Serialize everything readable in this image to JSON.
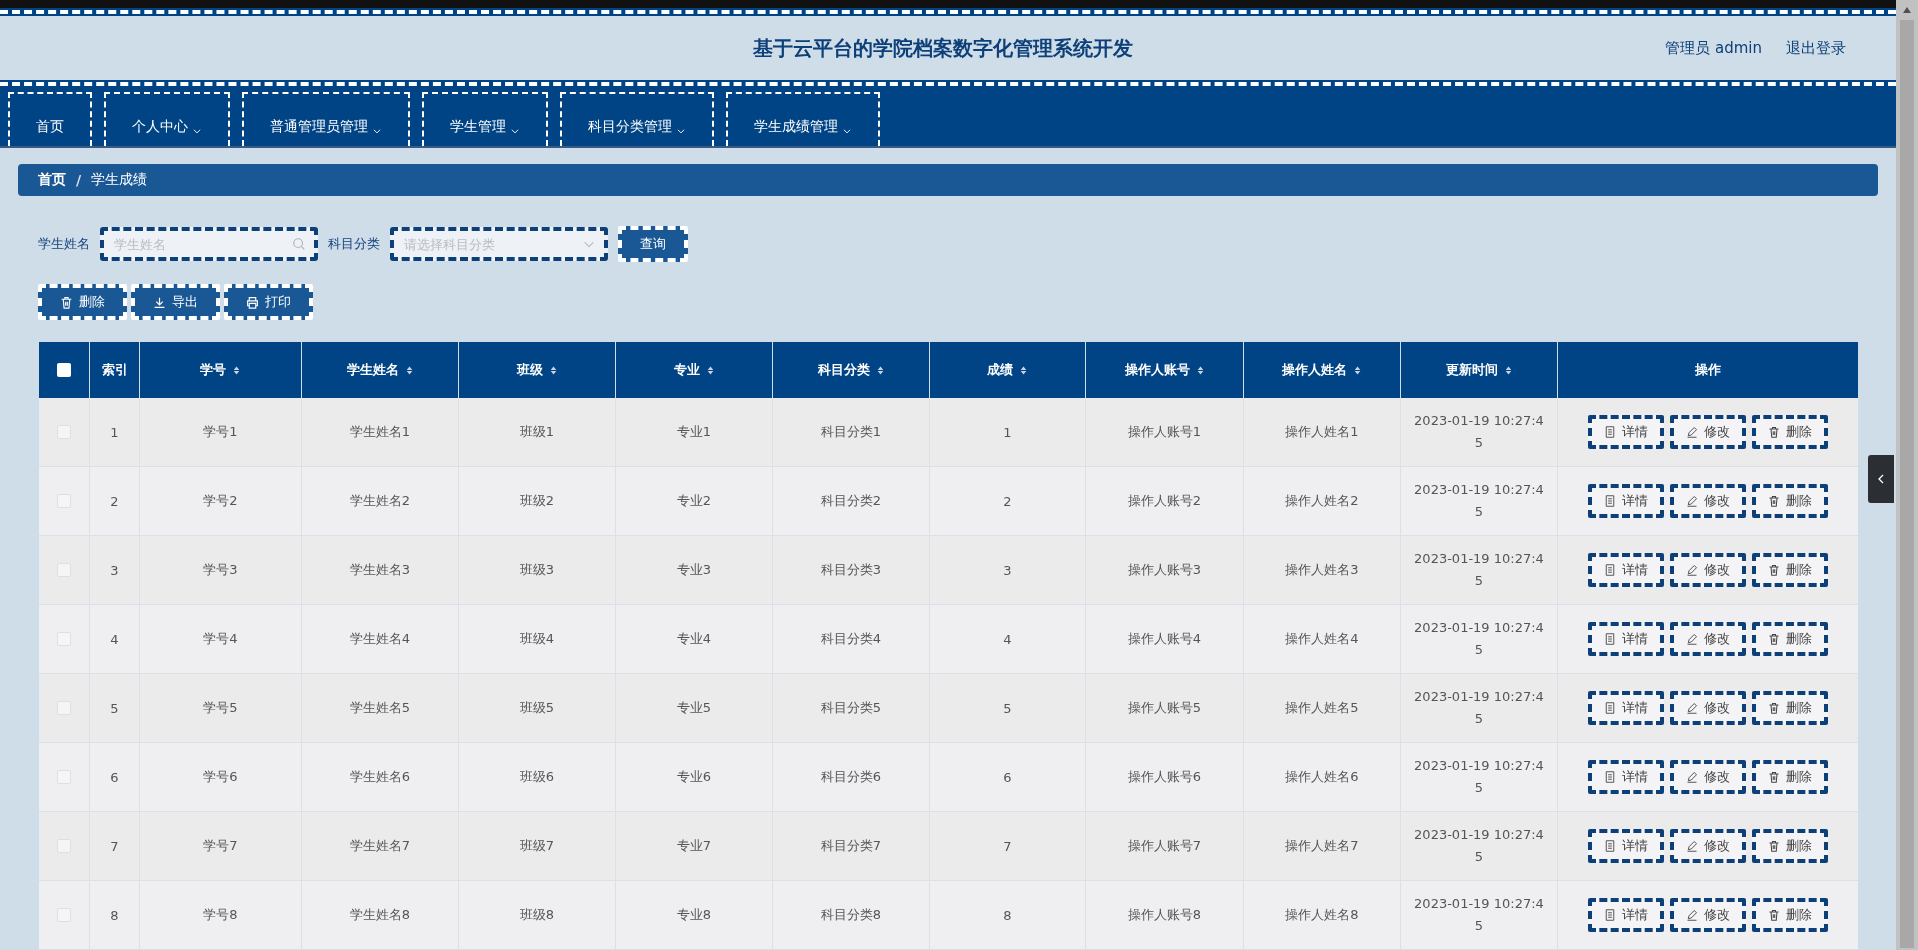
{
  "header": {
    "title": "基于云平台的学院档案数字化管理系统开发",
    "user": "管理员 admin",
    "logout": "退出登录"
  },
  "nav": [
    {
      "label": "首页",
      "dropdown": false
    },
    {
      "label": "个人中心",
      "dropdown": true
    },
    {
      "label": "普通管理员管理",
      "dropdown": true
    },
    {
      "label": "学生管理",
      "dropdown": true
    },
    {
      "label": "科目分类管理",
      "dropdown": true
    },
    {
      "label": "学生成绩管理",
      "dropdown": true
    }
  ],
  "breadcrumb": {
    "items": [
      "首页",
      "学生成绩"
    ],
    "separator": "/"
  },
  "search": [
    {
      "label": "学生姓名",
      "placeholder": "学生姓名",
      "kind": "text"
    },
    {
      "label": "科目分类",
      "placeholder": "请选择科目分类",
      "kind": "select"
    }
  ],
  "search_button": "查询",
  "actions": [
    {
      "label": "删除",
      "kind": "delete"
    },
    {
      "label": "导出",
      "kind": "export"
    },
    {
      "label": "打印",
      "kind": "print"
    }
  ],
  "table": {
    "select_all": false,
    "columns": [
      {
        "label": "索引",
        "sortable": false
      },
      {
        "label": "学号",
        "sortable": true
      },
      {
        "label": "学生姓名",
        "sortable": true
      },
      {
        "label": "班级",
        "sortable": true
      },
      {
        "label": "专业",
        "sortable": true
      },
      {
        "label": "科目分类",
        "sortable": true
      },
      {
        "label": "成绩",
        "sortable": true
      },
      {
        "label": "操作人账号",
        "sortable": true
      },
      {
        "label": "操作人姓名",
        "sortable": true
      },
      {
        "label": "更新时间",
        "sortable": true
      },
      {
        "label": "操作",
        "sortable": false
      }
    ],
    "rows": [
      {
        "checked": false,
        "cells": [
          "1",
          "学号1",
          "学生姓名1",
          "班级1",
          "专业1",
          "科目分类1",
          "1",
          "操作人账号1",
          "操作人姓名1",
          "2023-01-19 10:27:45"
        ],
        "actions": [
          {
            "label": "详情",
            "kind": "details"
          },
          {
            "label": "修改",
            "kind": "edit"
          },
          {
            "label": "删除",
            "kind": "delete"
          }
        ]
      },
      {
        "checked": false,
        "cells": [
          "2",
          "学号2",
          "学生姓名2",
          "班级2",
          "专业2",
          "科目分类2",
          "2",
          "操作人账号2",
          "操作人姓名2",
          "2023-01-19 10:27:45"
        ],
        "actions": [
          {
            "label": "详情",
            "kind": "details"
          },
          {
            "label": "修改",
            "kind": "edit"
          },
          {
            "label": "删除",
            "kind": "delete"
          }
        ]
      },
      {
        "checked": false,
        "cells": [
          "3",
          "学号3",
          "学生姓名3",
          "班级3",
          "专业3",
          "科目分类3",
          "3",
          "操作人账号3",
          "操作人姓名3",
          "2023-01-19 10:27:45"
        ],
        "actions": [
          {
            "label": "详情",
            "kind": "details"
          },
          {
            "label": "修改",
            "kind": "edit"
          },
          {
            "label": "删除",
            "kind": "delete"
          }
        ]
      },
      {
        "checked": false,
        "cells": [
          "4",
          "学号4",
          "学生姓名4",
          "班级4",
          "专业4",
          "科目分类4",
          "4",
          "操作人账号4",
          "操作人姓名4",
          "2023-01-19 10:27:45"
        ],
        "actions": [
          {
            "label": "详情",
            "kind": "details"
          },
          {
            "label": "修改",
            "kind": "edit"
          },
          {
            "label": "删除",
            "kind": "delete"
          }
        ]
      },
      {
        "checked": false,
        "cells": [
          "5",
          "学号5",
          "学生姓名5",
          "班级5",
          "专业5",
          "科目分类5",
          "5",
          "操作人账号5",
          "操作人姓名5",
          "2023-01-19 10:27:45"
        ],
        "actions": [
          {
            "label": "详情",
            "kind": "details"
          },
          {
            "label": "修改",
            "kind": "edit"
          },
          {
            "label": "删除",
            "kind": "delete"
          }
        ]
      },
      {
        "checked": false,
        "cells": [
          "6",
          "学号6",
          "学生姓名6",
          "班级6",
          "专业6",
          "科目分类6",
          "6",
          "操作人账号6",
          "操作人姓名6",
          "2023-01-19 10:27:45"
        ],
        "actions": [
          {
            "label": "详情",
            "kind": "details"
          },
          {
            "label": "修改",
            "kind": "edit"
          },
          {
            "label": "删除",
            "kind": "delete"
          }
        ]
      },
      {
        "checked": false,
        "cells": [
          "7",
          "学号7",
          "学生姓名7",
          "班级7",
          "专业7",
          "科目分类7",
          "7",
          "操作人账号7",
          "操作人姓名7",
          "2023-01-19 10:27:45"
        ],
        "actions": [
          {
            "label": "详情",
            "kind": "details"
          },
          {
            "label": "修改",
            "kind": "edit"
          },
          {
            "label": "删除",
            "kind": "delete"
          }
        ]
      },
      {
        "checked": false,
        "cells": [
          "8",
          "学号8",
          "学生姓名8",
          "班级8",
          "专业8",
          "科目分类8",
          "8",
          "操作人账号8",
          "操作人姓名8",
          "2023-01-19 10:27:45"
        ],
        "actions": [
          {
            "label": "详情",
            "kind": "details"
          },
          {
            "label": "修改",
            "kind": "edit"
          },
          {
            "label": "删除",
            "kind": "delete"
          }
        ]
      }
    ]
  }
}
